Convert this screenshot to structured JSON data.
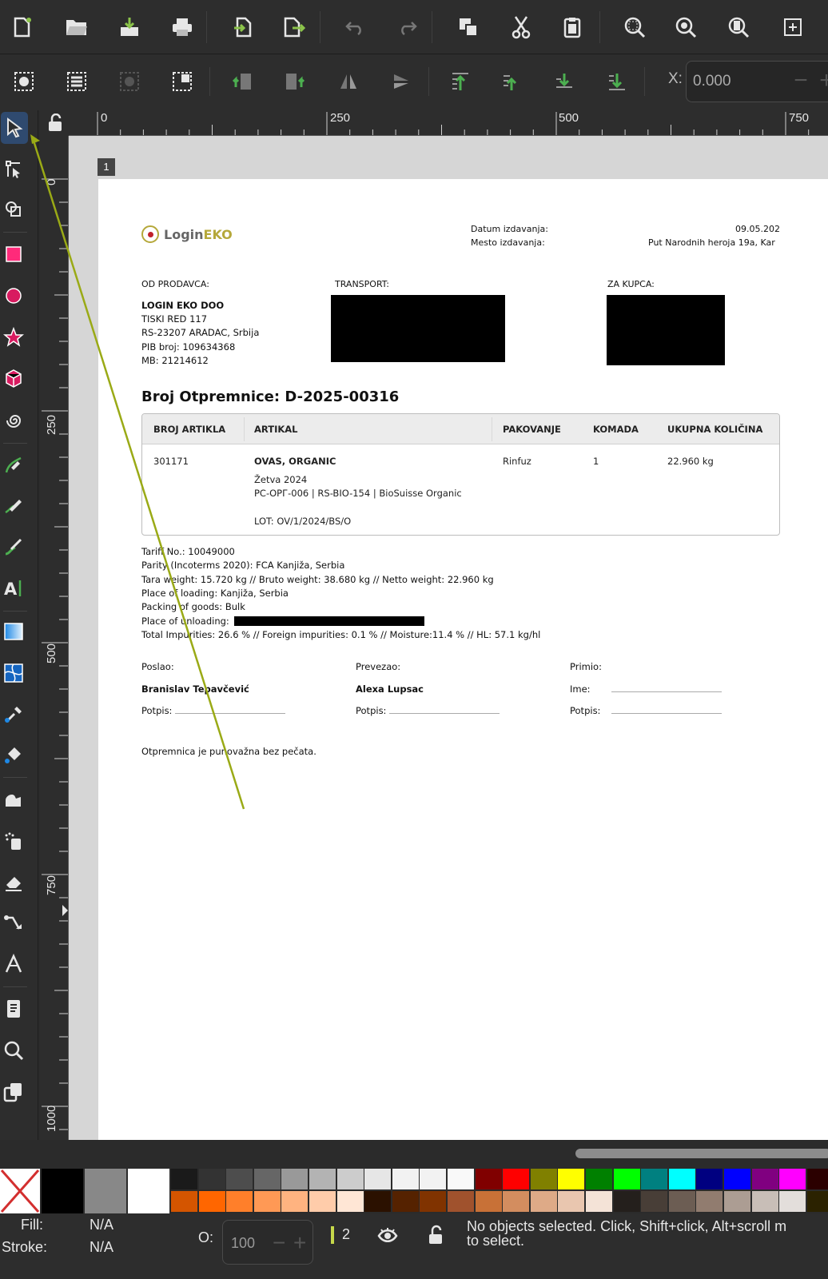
{
  "toolbar": {
    "commands": [
      "new-document",
      "open-file",
      "import",
      "print",
      "export-page",
      "export-as",
      "undo",
      "redo",
      "duplicate",
      "cut",
      "paste",
      "zoom-selection",
      "zoom-drawing",
      "zoom-page",
      "zoom-center"
    ],
    "context_commands": [
      "select-all",
      "select-all-layers",
      "deselect",
      "select-same",
      "rotate-ccw",
      "rotate-cw",
      "flip-horizontal",
      "flip-vertical",
      "raise-to-top",
      "raise",
      "lower",
      "lower-to-bottom"
    ],
    "x_label": "X:",
    "x_value": "0.000"
  },
  "tools": [
    "selector",
    "node",
    "shape-builder",
    "rectangle",
    "ellipse",
    "star",
    "3d-box",
    "spiral",
    "pen",
    "pencil",
    "calligraphy",
    "text",
    "gradient",
    "mesh",
    "dropper",
    "paint-bucket",
    "tweak",
    "spray",
    "eraser",
    "connector",
    "measure",
    "pages",
    "zoom",
    "clone"
  ],
  "rulers": {
    "horizontal": [
      "0",
      "250",
      "500",
      "750"
    ],
    "vertical": [
      "0",
      "250",
      "500",
      "750",
      "1000"
    ]
  },
  "canvas": {
    "page_number": "1"
  },
  "document": {
    "logo_login": "Login",
    "logo_eko": "EKO",
    "datum_label": "Datum izdavanja:",
    "datum_value": "09.05.202",
    "mesto_label": "Mesto izdavanja:",
    "mesto_value": "Put Narodnih heroja 19a, Kar",
    "seller_label": "OD PRODAVCA:",
    "transport_label": "TRANSPORT:",
    "buyer_label": "ZA KUPCA:",
    "seller_lines": [
      "LOGIN EKO DOO",
      "TISKI RED 117",
      "RS-23207 ARADAC, Srbija",
      "PIB broj: 109634368",
      "MB: 21214612"
    ],
    "title": "Broj Otpremnice: D-2025-00316",
    "table": {
      "headers": [
        "BROJ ARTIKLA",
        "ARTIKAL",
        "PAKOVANJE",
        "KOMADA",
        "UKUPNA KOLIČINA"
      ],
      "row": {
        "broj": "301171",
        "artikal": "OVAS, ORGANIC",
        "pakovanje": "Rinfuz",
        "komada": "1",
        "kolicina": "22.960 kg",
        "details": [
          "Žetva 2024",
          "РС-ОРГ-006 | RS-BIO-154 | BioSuisse Organic",
          "",
          "LOT: OV/1/2024/BS/O"
        ]
      }
    },
    "info_lines": [
      "Tariff No.: 10049000",
      "Parity (Incoterms 2020): FCA Kanjiža, Serbia",
      "Tara weight: 15.720 kg // Bruto weight: 38.680 kg // Netto weight: 22.960 kg",
      "Place of loading: Kanjiža, Serbia",
      "Packing of goods: Bulk",
      "Place of unloading:",
      "Total Impurities: 26.6 % // Foreign impurities: 0.1 % // Moisture:11.4 % // HL: 57.1 kg/hl"
    ],
    "sign": {
      "poslao_label": "Poslao:",
      "poslao_name": "Branislav Tepavčević",
      "prevezao_label": "Prevezao:",
      "prevezao_name": "Alexa Lupsac",
      "primio_label": "Primio:",
      "ime_label": "Ime:",
      "potpis_label": "Potpis:"
    },
    "footer_note": "Otpremnica je punovažna bez pečata."
  },
  "palette": {
    "top": [
      "#000000",
      "#888888",
      "#ffffff",
      "#1a1a1a",
      "#333333",
      "#4d4d4d",
      "#666666",
      "#999999",
      "#b3b3b3",
      "#cccccc",
      "#e6e6e6",
      "#f2f2f2",
      "#f2f2f2",
      "#f9f9f9",
      "#800000",
      "#ff0000",
      "#808000",
      "#ffff00",
      "#008000",
      "#00ff00",
      "#008080",
      "#00ffff",
      "#000080",
      "#0000ff",
      "#800080",
      "#ff00ff",
      "#2b0000"
    ],
    "bottom": [
      "#d45500",
      "#ff6600",
      "#ff7f2a",
      "#ff9955",
      "#ffb380",
      "#ffccaa",
      "#ffe6d5",
      "#2b1100",
      "#552200",
      "#803300",
      "#a0522d",
      "#c87137",
      "#d38d5f",
      "#deaa87",
      "#e9c6af",
      "#f4e3d7",
      "#241f1c",
      "#483e37",
      "#6c5d53",
      "#917c6f",
      "#ac9d93",
      "#c8beb7",
      "#e3dedb",
      "#2b2200"
    ]
  },
  "status": {
    "fill_label": "Fill:",
    "fill_value": "N/A",
    "stroke_label": "Stroke:",
    "stroke_value": "N/A",
    "opacity_label": "O:",
    "opacity_value": "100",
    "layer_value": "2",
    "message_line1": "No objects selected. Click, Shift+click, Alt+scroll m",
    "message_line2": "to select."
  }
}
